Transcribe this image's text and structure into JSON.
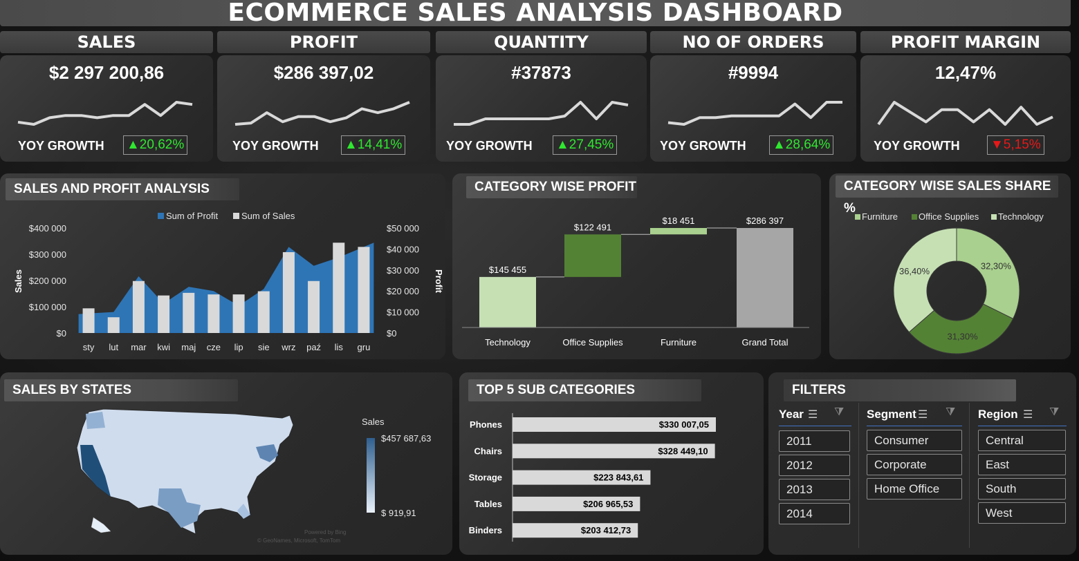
{
  "dashboard": {
    "title": "ECOMMERCE SALES ANALYSIS DASHBOARD"
  },
  "kpis": [
    {
      "label": "SALES",
      "value": "$2 297 200,86",
      "yoy_label": "YOY GROWTH",
      "yoy": "▲20,62%",
      "trend": "up",
      "spark": [
        3,
        2,
        5,
        6,
        6,
        5,
        6,
        6,
        11,
        6,
        12,
        11
      ]
    },
    {
      "label": "PROFIT",
      "value": "$286 397,02",
      "yoy_label": "YOY GROWTH",
      "yoy": "▲14,41%",
      "trend": "up",
      "spark": [
        2,
        3,
        11,
        4,
        8,
        8,
        4,
        7,
        14,
        11,
        14,
        19
      ]
    },
    {
      "label": "QUANTITY",
      "value": "#37873",
      "yoy_label": "YOY GROWTH",
      "yoy": "▲27,45%",
      "trend": "up",
      "spark": [
        4,
        4,
        6,
        6,
        6,
        6,
        6,
        7,
        12,
        6,
        12,
        11
      ]
    },
    {
      "label": "NO OF ORDERS",
      "value": "#9994",
      "yoy_label": "YOY GROWTH",
      "yoy": "▲28,64%",
      "trend": "up",
      "spark": [
        3,
        2,
        6,
        6,
        7,
        7,
        7,
        7,
        14,
        6,
        15,
        15
      ]
    },
    {
      "label": "PROFIT MARGIN",
      "value": "12,47%",
      "yoy_label": "YOY GROWTH",
      "yoy": "▼5,15%",
      "trend": "down",
      "spark": [
        2,
        11,
        7,
        3,
        8,
        8,
        3,
        8,
        2,
        9,
        2,
        5
      ]
    }
  ],
  "sales_profit": {
    "title": "SALES AND PROFIT ANALYSIS",
    "legend_profit": "Sum of Profit",
    "legend_sales": "Sum of Sales",
    "ylabel_left": "Sales",
    "ylabel_right": "Profit",
    "left_ticks": [
      "$400 000",
      "$300 000",
      "$200 000",
      "$100 000",
      "$0"
    ],
    "right_ticks": [
      "$50 000",
      "$40 000",
      "$30 000",
      "$20 000",
      "$10 000",
      "$0"
    ]
  },
  "category_profit": {
    "title": "CATEGORY WISE PROFIT",
    "labels": [
      "$145 455",
      "$122 491",
      "$18 451",
      "$286 397"
    ]
  },
  "category_share": {
    "title": "CATEGORY WISE SALES SHARE %",
    "legend": [
      "Furniture",
      "Office Supplies",
      "Technology"
    ],
    "labels": [
      "32,30%",
      "31,30%",
      "36,40%"
    ]
  },
  "states": {
    "title": "SALES BY STATES",
    "legend_title": "Sales",
    "legend_max": "$457 687,63",
    "legend_min": "$ 919,91",
    "credit_1": "Powered by Bing",
    "credit_2": "© GeoNames, Microsoft, TomTom"
  },
  "top5": {
    "title": "TOP 5 SUB CATEGORIES",
    "labels": [
      "$330 007,05",
      "$328 449,10",
      "$223 843,61",
      "$206 965,53",
      "$203 412,73"
    ]
  },
  "filters": {
    "title": "FILTERS",
    "year": {
      "label": "Year",
      "items": [
        "2011",
        "2012",
        "2013",
        "2014"
      ]
    },
    "segment": {
      "label": "Segment",
      "items": [
        "Consumer",
        "Corporate",
        "Home Office"
      ]
    },
    "region": {
      "label": "Region",
      "items": [
        "Central",
        "East",
        "South",
        "West"
      ]
    }
  },
  "chart_data": [
    {
      "type": "bar",
      "title": "",
      "categories": [
        "sty",
        "lut",
        "mar",
        "kwi",
        "maj",
        "cze",
        "lip",
        "sie",
        "wrz",
        "paź",
        "lis",
        "gru"
      ],
      "series": [
        {
          "name": "Sum of Sales",
          "axis": "left",
          "type": "bar",
          "values": [
            94000,
            60000,
            198000,
            143000,
            153000,
            147000,
            147000,
            159000,
            308000,
            198000,
            344000,
            328000
          ]
        },
        {
          "name": "Sum of Profit",
          "axis": "right",
          "type": "area",
          "values": [
            9000,
            10000,
            27000,
            14000,
            22000,
            20000,
            13000,
            21000,
            41000,
            32000,
            36000,
            43000
          ]
        }
      ],
      "xlabel": "",
      "ylabel": "Sales",
      "ylabel_right": "Profit",
      "ylim": [
        0,
        400000
      ],
      "ylim_right": [
        0,
        50000
      ],
      "grid": false,
      "legend": "top"
    },
    {
      "type": "bar",
      "title": "CATEGORY WISE PROFIT",
      "subtype": "waterfall",
      "categories": [
        "Technology",
        "Office Supplies",
        "Furniture",
        "Grand Total"
      ],
      "values": [
        145455,
        122491,
        18451,
        286397
      ],
      "ylim": [
        0,
        300000
      ],
      "legend": "none"
    },
    {
      "type": "pie",
      "subtype": "donut",
      "title": "CATEGORY WISE SALES SHARE %",
      "categories": [
        "Furniture",
        "Office Supplies",
        "Technology"
      ],
      "values": [
        32.3,
        31.3,
        36.4
      ],
      "colors": [
        "#a9d08e",
        "#548235",
        "#c6e0b4"
      ],
      "legend": "top"
    },
    {
      "type": "bar",
      "orientation": "horizontal",
      "title": "TOP 5 SUB CATEGORIES",
      "categories": [
        "Phones",
        "Chairs",
        "Storage",
        "Tables",
        "Binders"
      ],
      "values": [
        330007.05,
        328449.1,
        223843.61,
        206965.53,
        203412.73
      ],
      "legend": "none"
    }
  ]
}
